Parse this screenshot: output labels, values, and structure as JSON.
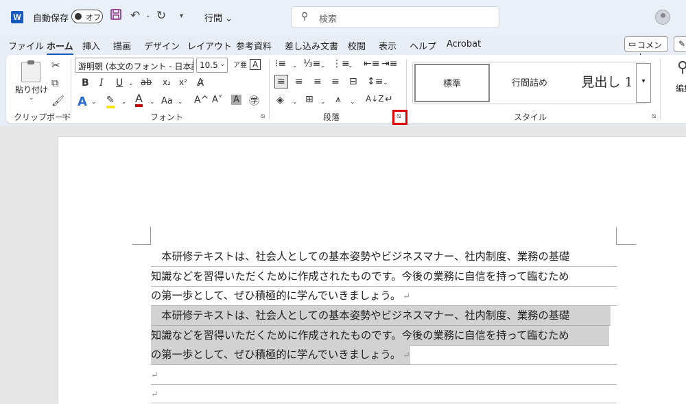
{
  "titlebar": {
    "app_logo": "W",
    "autosave_label": "自動保存",
    "autosave_state": "オフ",
    "doc_title": "行間",
    "search_placeholder": "検索"
  },
  "tabs": [
    "ファイル",
    "ホーム",
    "挿入",
    "描画",
    "デザイン",
    "レイアウト",
    "参考資料",
    "差し込み文書",
    "校閲",
    "表示",
    "ヘルプ",
    "Acrobat"
  ],
  "active_tab": "ホーム",
  "comment_button": "コメント",
  "ribbon": {
    "clipboard": {
      "paste_label": "貼り付け",
      "group_label": "クリップボード"
    },
    "font": {
      "font_name": "游明朝 (本文のフォント - 日本語)",
      "font_size": "10.5",
      "bold": "B",
      "italic": "I",
      "underline": "U",
      "strike": "ab",
      "subscript": "x₂",
      "superscript": "x²",
      "grow": "A^",
      "shrink": "A˅",
      "case": "Aa",
      "group_label": "フォント"
    },
    "paragraph": {
      "group_label": "段落"
    },
    "styles": {
      "items": [
        "標準",
        "行間詰め",
        "見出し 1"
      ],
      "group_label": "スタイル"
    },
    "editing": {
      "label": "編集"
    }
  },
  "document": {
    "lines": [
      "　本研修テキストは、社会人としての基本姿勢やビジネスマナー、社内制度、業務の基礎",
      "知識などを習得いただくために作成されたものです。今後の業務に自信を持って臨むため",
      "の第一歩として、ぜひ積極的に学んでいきましょう。",
      "　本研修テキストは、社会人としての基本姿勢やビジネスマナー、社内制度、業務の基礎",
      "知識などを習得いただくために作成されたものです。今後の業務に自信を持って臨むため",
      "の第一歩として、ぜひ積極的に学んでいきましょう。",
      "",
      ""
    ],
    "paragraph_mark": "↵"
  }
}
